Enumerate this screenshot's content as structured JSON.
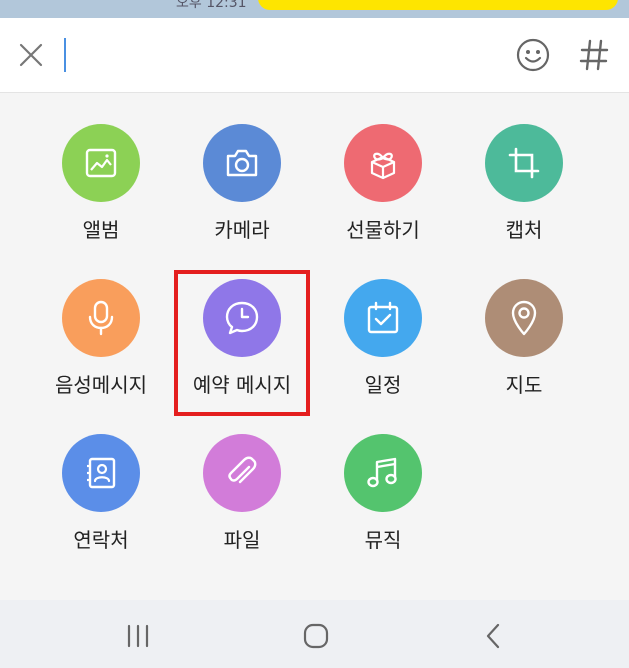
{
  "colors": {
    "album": "#8cd155",
    "camera": "#5b8ad6",
    "gift": "#ee6a72",
    "capture": "#4dba9a",
    "voice": "#f99e5c",
    "scheduled": "#8f77e8",
    "calendar": "#44a8ee",
    "map": "#ae8d76",
    "contacts": "#5b8ee8",
    "file": "#d27cd9",
    "music": "#54c46e",
    "highlight": "#e41e1e"
  },
  "grid": {
    "items": [
      {
        "label": "앨범",
        "icon": "image-icon"
      },
      {
        "label": "카메라",
        "icon": "camera-icon"
      },
      {
        "label": "선물하기",
        "icon": "gift-icon"
      },
      {
        "label": "캡처",
        "icon": "crop-icon"
      },
      {
        "label": "음성메시지",
        "icon": "microphone-icon"
      },
      {
        "label": "예약 메시지",
        "icon": "clock-chat-icon"
      },
      {
        "label": "일정",
        "icon": "calendar-check-icon"
      },
      {
        "label": "지도",
        "icon": "map-pin-icon"
      },
      {
        "label": "연락처",
        "icon": "contact-card-icon"
      },
      {
        "label": "파일",
        "icon": "paperclip-icon"
      },
      {
        "label": "뮤직",
        "icon": "music-note-icon"
      }
    ]
  },
  "chat": {
    "time": "오후 12:31"
  }
}
